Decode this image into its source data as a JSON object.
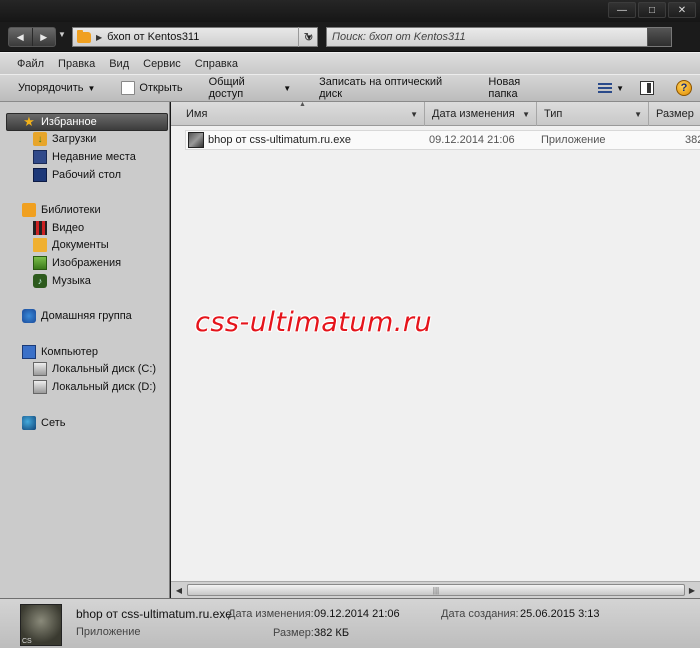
{
  "window": {
    "minimize": "—",
    "maximize": "□",
    "close": "✕"
  },
  "nav": {
    "back": "◀",
    "forward": "▶",
    "recent": "▼"
  },
  "address": {
    "separator": "▶",
    "path": "бхоп от Kentos311",
    "dropdown": "▼",
    "refresh": "↻"
  },
  "search": {
    "placeholder": "Поиск: бхоп от Kentos311"
  },
  "menu": [
    "Файл",
    "Правка",
    "Вид",
    "Сервис",
    "Справка"
  ],
  "toolbar": {
    "organize": "Упорядочить",
    "open": "Открыть",
    "share": "Общий доступ",
    "burn": "Записать на оптический диск",
    "new_folder": "Новая папка",
    "help": "?"
  },
  "sidebar": {
    "favorites": {
      "label": "Избранное",
      "items": [
        "Загрузки",
        "Недавние места",
        "Рабочий стол"
      ]
    },
    "libraries": {
      "label": "Библиотеки",
      "items": [
        "Видео",
        "Документы",
        "Изображения",
        "Музыка"
      ]
    },
    "homegroup": {
      "label": "Домашняя группа"
    },
    "computer": {
      "label": "Компьютер",
      "items": [
        "Локальный диск (C:)",
        "Локальный диск (D:)"
      ]
    },
    "network": {
      "label": "Сеть"
    }
  },
  "columns": {
    "name": "Имя",
    "modified": "Дата изменения",
    "type": "Тип",
    "size": "Размер"
  },
  "files": [
    {
      "name": "bhop от css-ultimatum.ru.exe",
      "modified": "09.12.2014 21:06",
      "type": "Приложение",
      "size": "382"
    }
  ],
  "watermark": "css-ultimatum.ru",
  "details": {
    "filename": "bhop от css-ultimatum.ru.exe",
    "type": "Приложение",
    "modified_label": "Дата изменения:",
    "modified_value": "09.12.2014 21:06",
    "created_label": "Дата создания:",
    "created_value": "25.06.2015 3:13",
    "size_label": "Размер:",
    "size_value": "382 КБ",
    "thumb_tag": "CS"
  },
  "colors": {
    "chrome_dark": "#161616",
    "pane_gray": "#cbcbcb",
    "content_bg": "#f0f0f0",
    "selected": "#4a4a4a",
    "watermark": "#e5141b",
    "folder": "#f0a020"
  }
}
